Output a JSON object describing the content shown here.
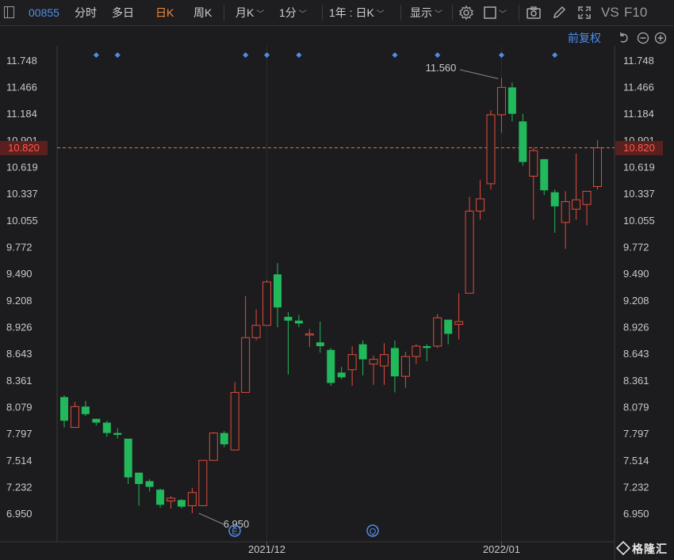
{
  "toolbar": {
    "code": "00855",
    "tabs": [
      "分时",
      "多日",
      "日K",
      "周K"
    ],
    "active_tab": "日K",
    "month_k": "月K",
    "minute": "1分",
    "range": "1年 : 日K",
    "display": "显示",
    "vs_label": "VS",
    "f10_label": "F10"
  },
  "sub": {
    "adjust": "前复权"
  },
  "colors": {
    "up": "#e24b3b",
    "down": "#22b85c",
    "accent": "#f08a3a",
    "link": "#4f8de8"
  },
  "chart_data": {
    "type": "candlestick",
    "y_ticks": [
      11.748,
      11.466,
      11.184,
      10.901,
      10.619,
      10.337,
      10.055,
      9.772,
      9.49,
      9.208,
      8.926,
      8.643,
      8.361,
      8.079,
      7.797,
      7.514,
      7.232,
      6.95
    ],
    "y_tick_labels": [
      "11.748",
      "11.466",
      "11.184",
      "10.901",
      "10.619",
      "10.337",
      "10.055",
      "9.772",
      "9.490",
      "9.208",
      "8.926",
      "8.643",
      "8.361",
      "8.079",
      "7.797",
      "7.514",
      "7.232",
      "6.950"
    ],
    "ylim": [
      6.95,
      11.748
    ],
    "x_labels": [
      {
        "index": 19,
        "label": "2021/12"
      },
      {
        "index": 41,
        "label": "2022/01"
      }
    ],
    "current_price": 10.82,
    "current_price_label": "10.820",
    "max_annotation": {
      "index": 41,
      "value": 11.56,
      "label": "11.560"
    },
    "min_annotation": {
      "index": 13,
      "value": 6.95,
      "label": "6.950"
    },
    "markers_top": [
      3,
      5,
      17,
      19,
      22,
      31,
      35,
      41,
      46
    ],
    "event_badges": [
      {
        "index": 16,
        "letter": "E"
      },
      {
        "index": 29,
        "letter": "Q"
      }
    ],
    "candles": [
      {
        "o": 8.18,
        "h": 8.2,
        "c": 7.93,
        "l": 7.86
      },
      {
        "o": 7.86,
        "h": 8.13,
        "c": 8.08,
        "l": 7.86
      },
      {
        "o": 8.08,
        "h": 8.14,
        "c": 8.0,
        "l": 7.98
      },
      {
        "o": 7.95,
        "h": 7.95,
        "c": 7.91,
        "l": 7.88
      },
      {
        "o": 7.91,
        "h": 7.93,
        "c": 7.8,
        "l": 7.76
      },
      {
        "o": 7.8,
        "h": 7.85,
        "c": 7.78,
        "l": 7.74
      },
      {
        "o": 7.74,
        "h": 7.74,
        "c": 7.33,
        "l": 7.26
      },
      {
        "o": 7.38,
        "h": 7.38,
        "c": 7.26,
        "l": 7.03
      },
      {
        "o": 7.29,
        "h": 7.31,
        "c": 7.23,
        "l": 7.18
      },
      {
        "o": 7.2,
        "h": 7.21,
        "c": 7.04,
        "l": 7.01
      },
      {
        "o": 7.08,
        "h": 7.13,
        "c": 7.11,
        "l": 7.0
      },
      {
        "o": 7.09,
        "h": 7.1,
        "c": 7.02,
        "l": 7.0
      },
      {
        "o": 7.03,
        "h": 7.22,
        "c": 7.17,
        "l": 6.95
      },
      {
        "o": 7.03,
        "h": 7.51,
        "c": 7.51,
        "l": 7.03
      },
      {
        "o": 7.51,
        "h": 7.81,
        "c": 7.8,
        "l": 7.51
      },
      {
        "o": 7.8,
        "h": 7.82,
        "c": 7.68,
        "l": 7.65
      },
      {
        "o": 7.62,
        "h": 8.34,
        "c": 8.23,
        "l": 7.62
      },
      {
        "o": 8.23,
        "h": 9.25,
        "c": 8.81,
        "l": 8.23
      },
      {
        "o": 8.81,
        "h": 9.11,
        "c": 8.94,
        "l": 8.78
      },
      {
        "o": 8.94,
        "h": 9.42,
        "c": 9.4,
        "l": 8.94
      },
      {
        "o": 9.48,
        "h": 9.6,
        "c": 9.13,
        "l": 8.92
      },
      {
        "o": 9.03,
        "h": 9.08,
        "c": 8.99,
        "l": 8.42
      },
      {
        "o": 8.99,
        "h": 9.05,
        "c": 8.96,
        "l": 8.92
      },
      {
        "o": 8.85,
        "h": 8.9,
        "c": 8.85,
        "l": 8.71
      },
      {
        "o": 8.76,
        "h": 8.98,
        "c": 8.72,
        "l": 8.65
      },
      {
        "o": 8.68,
        "h": 8.7,
        "c": 8.33,
        "l": 8.3
      },
      {
        "o": 8.44,
        "h": 8.5,
        "c": 8.39,
        "l": 8.37
      },
      {
        "o": 8.47,
        "h": 8.72,
        "c": 8.63,
        "l": 8.3
      },
      {
        "o": 8.74,
        "h": 8.78,
        "c": 8.58,
        "l": 8.41
      },
      {
        "o": 8.53,
        "h": 8.62,
        "c": 8.58,
        "l": 8.31
      },
      {
        "o": 8.51,
        "h": 8.75,
        "c": 8.63,
        "l": 8.31
      },
      {
        "o": 8.7,
        "h": 8.78,
        "c": 8.4,
        "l": 8.23
      },
      {
        "o": 8.4,
        "h": 8.66,
        "c": 8.61,
        "l": 8.28
      },
      {
        "o": 8.61,
        "h": 8.74,
        "c": 8.72,
        "l": 8.53
      },
      {
        "o": 8.72,
        "h": 8.74,
        "c": 8.7,
        "l": 8.56
      },
      {
        "o": 8.72,
        "h": 9.06,
        "c": 9.02,
        "l": 8.7
      },
      {
        "o": 9.0,
        "h": 9.0,
        "c": 8.85,
        "l": 8.74
      },
      {
        "o": 8.95,
        "h": 9.28,
        "c": 8.98,
        "l": 8.79
      },
      {
        "o": 9.28,
        "h": 10.3,
        "c": 10.15,
        "l": 9.28
      },
      {
        "o": 10.15,
        "h": 10.48,
        "c": 10.28,
        "l": 10.06
      },
      {
        "o": 10.44,
        "h": 11.22,
        "c": 11.17,
        "l": 10.38
      },
      {
        "o": 11.17,
        "h": 11.56,
        "c": 11.46,
        "l": 10.98
      },
      {
        "o": 11.46,
        "h": 11.51,
        "c": 11.18,
        "l": 11.1
      },
      {
        "o": 11.1,
        "h": 11.18,
        "c": 10.67,
        "l": 10.63
      },
      {
        "o": 10.52,
        "h": 10.82,
        "c": 10.79,
        "l": 10.06
      },
      {
        "o": 10.7,
        "h": 10.7,
        "c": 10.37,
        "l": 10.32
      },
      {
        "o": 10.35,
        "h": 10.38,
        "c": 10.2,
        "l": 9.92
      },
      {
        "o": 10.03,
        "h": 10.36,
        "c": 10.25,
        "l": 9.75
      },
      {
        "o": 10.17,
        "h": 10.76,
        "c": 10.27,
        "l": 10.06
      },
      {
        "o": 10.22,
        "h": 10.36,
        "c": 10.36,
        "l": 10.0
      },
      {
        "o": 10.41,
        "h": 10.9,
        "c": 10.82,
        "l": 10.38
      }
    ]
  }
}
